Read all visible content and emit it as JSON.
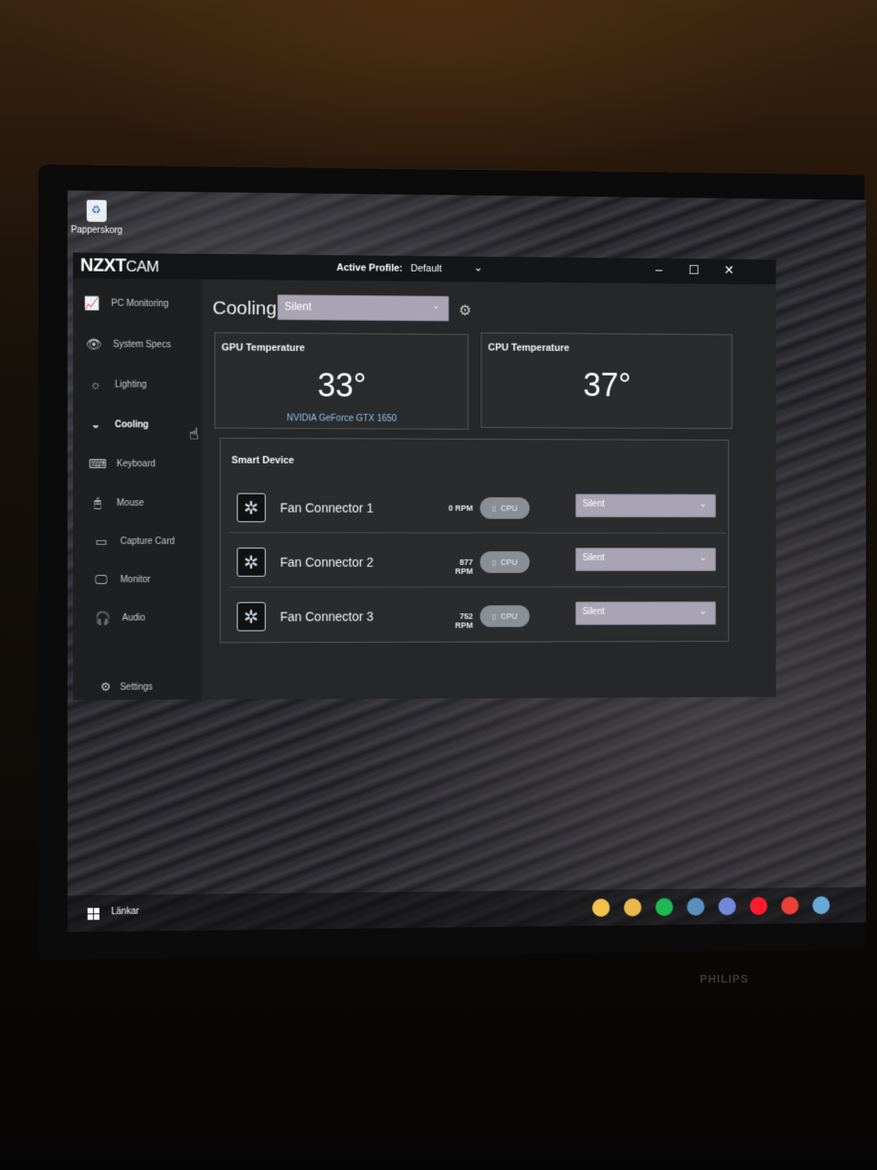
{
  "desktop": {
    "recycle_bin_label": "Papperskorg"
  },
  "titlebar": {
    "logo_main": "NZXT",
    "logo_sub": "CAM",
    "active_profile_label": "Active Profile:",
    "active_profile_value": "Default",
    "minimize": "–",
    "maximize": "☐",
    "close": "✕"
  },
  "sidebar": {
    "items": [
      {
        "label": "PC Monitoring",
        "icon": "chart-line-icon"
      },
      {
        "label": "System Specs",
        "icon": "eye-icon"
      },
      {
        "label": "Lighting",
        "icon": "sun-icon"
      },
      {
        "label": "Cooling",
        "icon": "fan-cooling-icon"
      },
      {
        "label": "Keyboard",
        "icon": "keyboard-icon"
      },
      {
        "label": "Mouse",
        "icon": "mouse-icon"
      },
      {
        "label": "Capture Card",
        "icon": "capture-card-icon"
      },
      {
        "label": "Monitor",
        "icon": "monitor-icon"
      },
      {
        "label": "Audio",
        "icon": "headset-icon"
      }
    ],
    "active": "Cooling",
    "settings_label": "Settings"
  },
  "cooling": {
    "title": "Cooling",
    "preset": "Silent",
    "gpu": {
      "title": "GPU Temperature",
      "value": "33°",
      "device": "NVIDIA GeForce GTX 1650"
    },
    "cpu": {
      "title": "CPU Temperature",
      "value": "37°"
    },
    "smart_device": {
      "title": "Smart Device",
      "fans": [
        {
          "name": "Fan Connector 1",
          "rpm": "0 RPM",
          "source": "CPU",
          "profile": "Silent"
        },
        {
          "name": "Fan Connector 2",
          "rpm": "877 RPM",
          "source": "CPU",
          "profile": "Silent"
        },
        {
          "name": "Fan Connector 3",
          "rpm": "752 RPM",
          "source": "CPU",
          "profile": "Silent"
        }
      ]
    }
  },
  "taskbar": {
    "label": "Länkar",
    "tray_icons": [
      "files-icon",
      "folder-icon",
      "spotify-icon",
      "steam-icon",
      "discord-icon",
      "opera-icon",
      "chrome-icon",
      "steam-tray-icon"
    ],
    "tray_colors": [
      "#f2c14e",
      "#e8b84a",
      "#1db954",
      "#5a8fbd",
      "#7289da",
      "#ff1b2d",
      "#e94235",
      "#66a9d8"
    ]
  },
  "monitor": {
    "brand": "PHILIPS"
  }
}
